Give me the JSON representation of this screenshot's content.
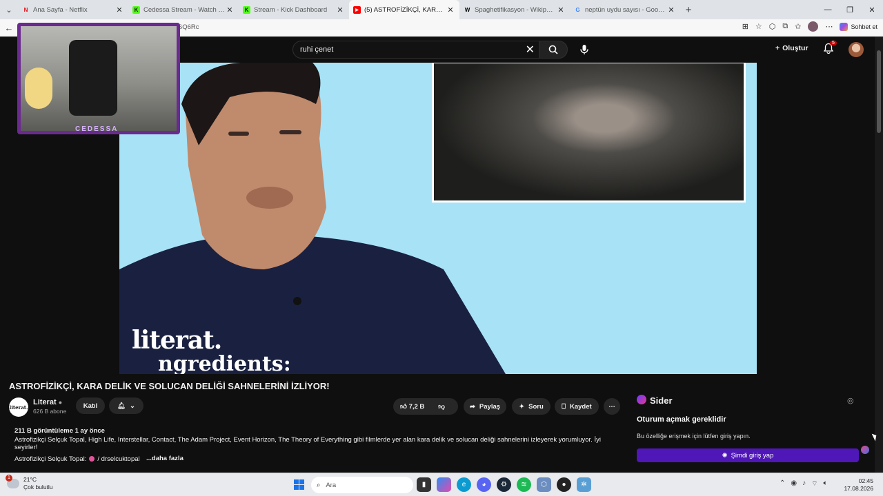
{
  "browser": {
    "tabs": [
      {
        "title": "Ana Sayfa - Netflix",
        "favicon": "N",
        "favicon_color": "#e50914"
      },
      {
        "title": "Cedessa Stream - Watch Live on K",
        "favicon": "K",
        "favicon_color": "#53fc18"
      },
      {
        "title": "Stream - Kick Dashboard",
        "favicon": "K",
        "favicon_color": "#53fc18"
      },
      {
        "title": "(5) ASTROFİZİKÇİ, KARA DELİK VE",
        "favicon": "▶",
        "favicon_color": "#ff0000"
      },
      {
        "title": "Spaghetifikasyon - Wikipedia",
        "favicon": "W",
        "favicon_color": "#000000"
      },
      {
        "title": "neptün uydu sayısı - Google'da Ar",
        "favicon": "G",
        "favicon_color": "#4285f4"
      }
    ],
    "url_visible": "...SQ6Rc",
    "copilot_label": "Sohbet et"
  },
  "youtube": {
    "search_value": "ruhi çenet",
    "create_label": "Oluştur",
    "notification_count": "5",
    "video": {
      "title": "ASTROFİZİKÇİ, KARA DELİK VE SOLUCAN DELİĞİ SAHNELERİNİ İZLİYOR!",
      "brand_line1": "literat.",
      "brand_line2": "ngredients:",
      "channel_name": "Literat",
      "channel_logo_text": "literat.",
      "subscribers": "626 B abone",
      "join_label": "Katıl",
      "likes": "7,2 B",
      "share_label": "Paylaş",
      "ask_label": "Soru",
      "save_label": "Kaydet",
      "views_time": "211 B görüntüleme  1 ay önce",
      "description": "Astrofizikçi Selçuk Topal, High Life, Interstellar, Contact, The Adam Project, Event Horizon, The Theory of Everything gibi filmlerde yer alan kara delik ve solucan deliği sahnelerini izleyerek yorumluyor. İyi seyirler!",
      "desc_link_prefix": "Astrofizikçi Selçuk Topal:",
      "desc_link": "/ drselcuktopal",
      "more_label": "...daha fazla"
    },
    "facecam_label": "CEDESSA"
  },
  "sider": {
    "name": "Sider",
    "heading": "Oturum açmak gereklidir",
    "message": "Bu özelliğe erişmek için lütfen giriş yapın.",
    "button": "Şimdi giriş yap"
  },
  "taskbar": {
    "weather_temp": "21°C",
    "weather_desc": "Çok bulutlu",
    "weather_badge": "1",
    "search_placeholder": "Ara",
    "time": "02:45",
    "date": "17.08.2026"
  }
}
